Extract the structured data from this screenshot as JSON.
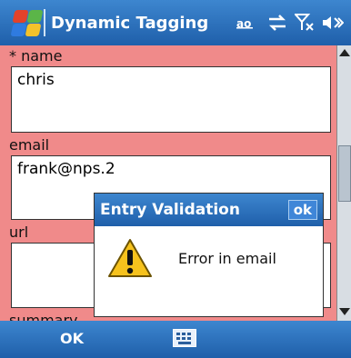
{
  "title_bar": {
    "title": "Dynamic Tagging",
    "icons": [
      "windows-start-icon",
      "bluetooth-ad-hoc-icon",
      "connectivity-icon",
      "signal-off-icon",
      "volume-icon"
    ],
    "status_text": "ﺍﻭ"
  },
  "form": {
    "fields": [
      {
        "label": "* name",
        "value": "chris"
      },
      {
        "label": "email",
        "value": "frank@nps.2"
      },
      {
        "label": "url",
        "value": ""
      },
      {
        "label": "summary",
        "value": ""
      }
    ],
    "background_color": "#f08a8a"
  },
  "dialog": {
    "title": "Entry Validation",
    "ok_label": "ok",
    "message": "Error in email",
    "icon": "warning-icon"
  },
  "menu_bar": {
    "left_label": "OK",
    "center_icon": "keyboard-icon"
  },
  "colors": {
    "bar_blue": "#1f5faa",
    "accent_red": "#f08a8a"
  }
}
